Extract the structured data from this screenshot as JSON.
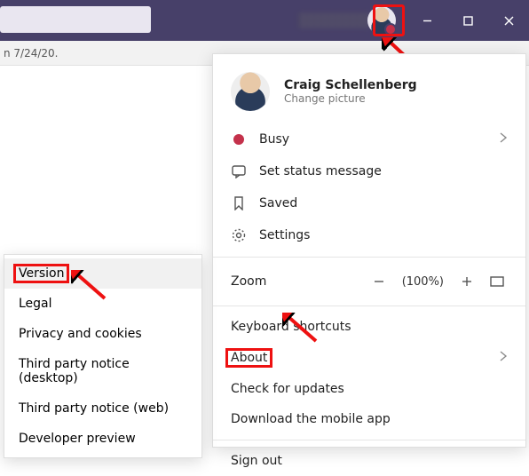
{
  "titlebar": {
    "min": "_",
    "max": "▢",
    "close": "✕"
  },
  "infobar": {
    "text": "n 7/24/20."
  },
  "profile": {
    "name": "Craig Schellenberg",
    "change_picture": "Change picture",
    "status_label": "Busy",
    "set_status": "Set status message",
    "saved": "Saved",
    "settings": "Settings"
  },
  "zoom": {
    "label": "Zoom",
    "percent": "(100%)"
  },
  "more": {
    "shortcuts": "Keyboard shortcuts",
    "about": "About",
    "updates": "Check for updates",
    "download": "Download the mobile app",
    "signout": "Sign out"
  },
  "about_menu": {
    "version": "Version",
    "legal": "Legal",
    "privacy": "Privacy and cookies",
    "tpn_desktop": "Third party notice (desktop)",
    "tpn_web": "Third party notice (web)",
    "dev_preview": "Developer preview"
  }
}
